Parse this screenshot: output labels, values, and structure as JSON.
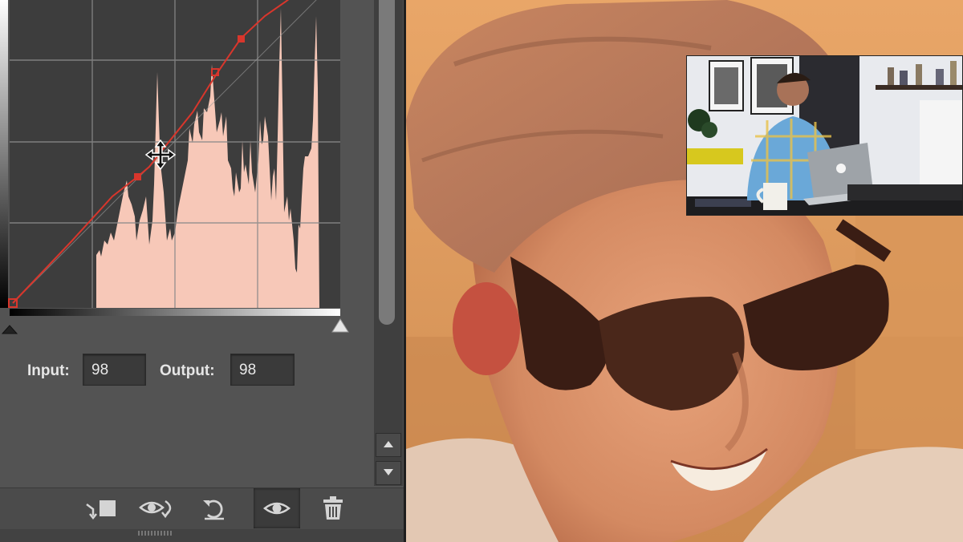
{
  "curves_panel": {
    "input_label": "Input:",
    "input_value": "98",
    "output_label": "Output:",
    "output_value": "98",
    "curve_color": "#d8362c",
    "histogram_color": "#f7c8b8",
    "graph_background": "#3d3d3d"
  },
  "toolbar": {
    "buttons": [
      {
        "name": "clip-to-layer-icon"
      },
      {
        "name": "view-previous-state-icon"
      },
      {
        "name": "reset-adjustment-icon"
      },
      {
        "name": "toggle-visibility-icon",
        "active": true
      },
      {
        "name": "delete-trash-icon"
      }
    ]
  },
  "scrollbar": {
    "up_icon": "chevron-up-icon",
    "down_icon": "chevron-down-icon"
  }
}
